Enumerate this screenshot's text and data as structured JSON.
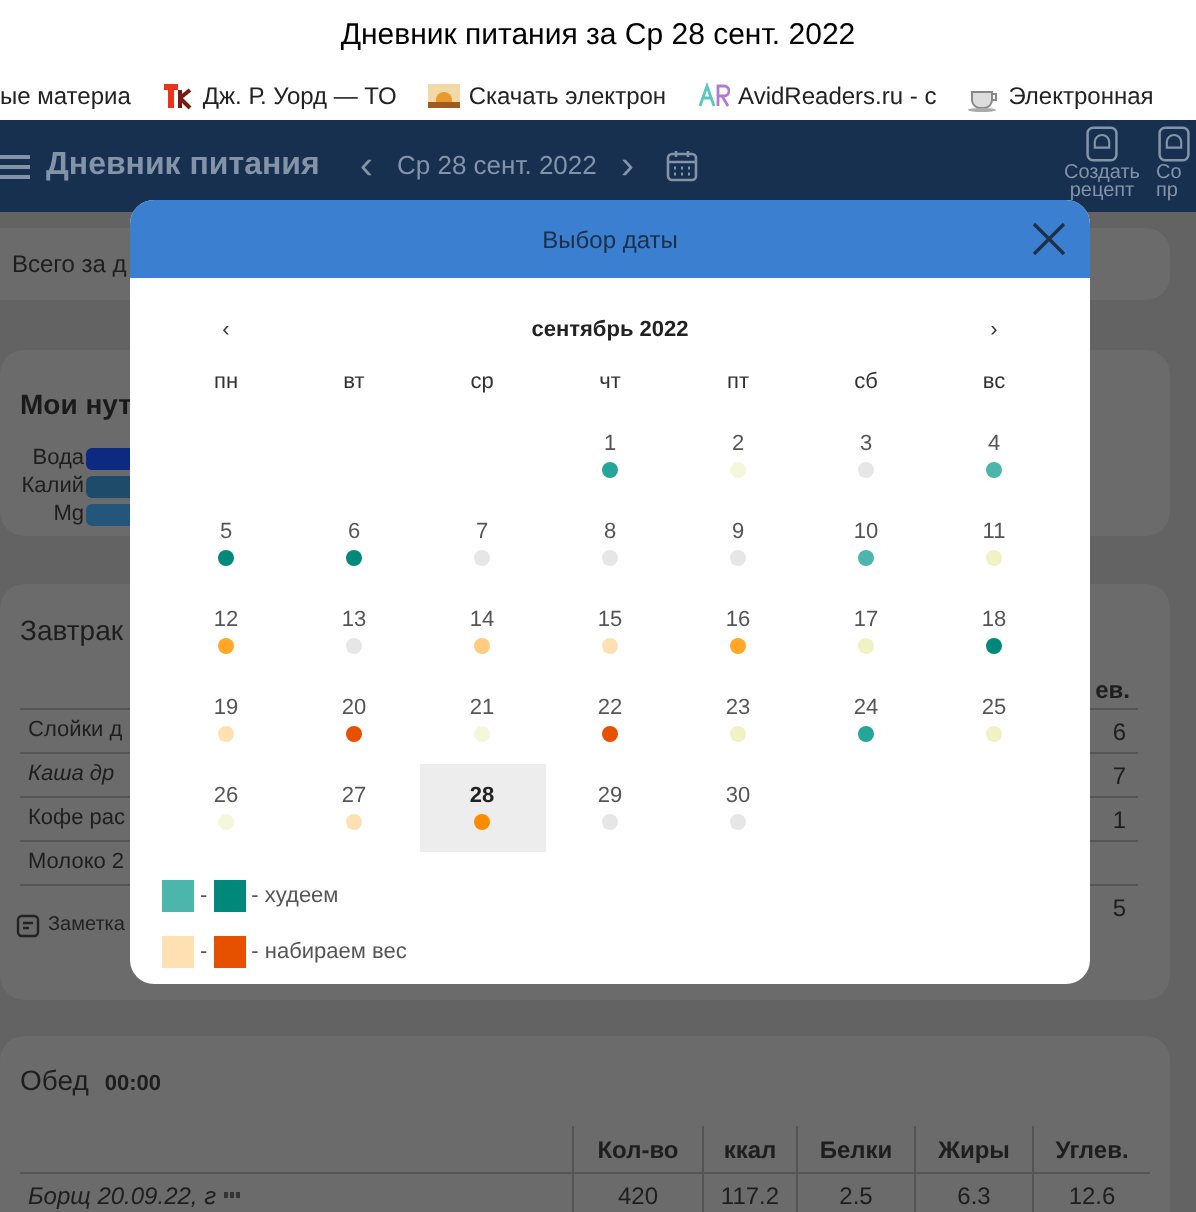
{
  "window": {
    "title": "Дневник питания за Ср 28 сент. 2022"
  },
  "bookmarks": [
    {
      "label": "ые материа"
    },
    {
      "label": "Дж. Р. Уорд — ТО"
    },
    {
      "label": "Скачать электрон"
    },
    {
      "label": "AvidReaders.ru - с"
    },
    {
      "label": "Электронная"
    }
  ],
  "header": {
    "title": "Дневник питания",
    "date": "Ср 28 сент. 2022",
    "prev": "‹",
    "next": "›",
    "actions": [
      [
        "Создать",
        "рецепт"
      ],
      [
        "Со",
        "пр"
      ]
    ]
  },
  "summary": {
    "label": "Всего за д"
  },
  "nutrients": {
    "title": "Мои нут",
    "items": [
      {
        "label": "Вода",
        "color": "#0c2a80"
      },
      {
        "label": "Калий",
        "color": "#1f4b6b"
      },
      {
        "label": "Mg",
        "color": "#24557a"
      }
    ]
  },
  "breakfast": {
    "title": "Завтрак",
    "column_right": "ев.",
    "rows": [
      {
        "name": "Слойки д",
        "italic": false,
        "value": "6"
      },
      {
        "name": "Каша др",
        "italic": true,
        "value": "7"
      },
      {
        "name": "Кофе рас",
        "italic": false,
        "value": "1"
      },
      {
        "name": "Молоко 2",
        "italic": false
      }
    ],
    "total": "5",
    "note": "Заметка"
  },
  "lunch": {
    "title": "Обед",
    "time": "00:00",
    "columns": [
      "Кол-во",
      "ккал",
      "Белки",
      "Жиры",
      "Углев."
    ],
    "rows": [
      {
        "name": "Борщ 20.09.22, г",
        "italic": true,
        "cells": [
          "420",
          "117.2",
          "2.5",
          "6.3",
          "12.6"
        ]
      }
    ]
  },
  "dialog": {
    "title": "Выбор даты",
    "prev": "‹",
    "next": "›",
    "month": "сентябрь 2022",
    "weekdays": [
      "пн",
      "вт",
      "ср",
      "чт",
      "пт",
      "сб",
      "вс"
    ],
    "weeks": [
      {
        "kind": "first",
        "days": [
          {
            "day": "1",
            "color": "#26a69a",
            "selected": false
          },
          {
            "day": "2",
            "color": "#f5f7dc",
            "selected": false
          },
          {
            "day": "3",
            "color": "#e6e6e6",
            "selected": false
          },
          {
            "day": "4",
            "color": "#4db6ac",
            "selected": false
          }
        ]
      },
      {
        "kind": "full",
        "days": [
          {
            "day": "5",
            "color": "#00897b",
            "selected": false
          },
          {
            "day": "6",
            "color": "#00897b",
            "selected": false
          },
          {
            "day": "7",
            "color": "#e6e6e6",
            "selected": false
          },
          {
            "day": "8",
            "color": "#e6e6e6",
            "selected": false
          },
          {
            "day": "9",
            "color": "#e6e6e6",
            "selected": false
          },
          {
            "day": "10",
            "color": "#4db6ac",
            "selected": false
          },
          {
            "day": "11",
            "color": "#eef2c4",
            "selected": false
          }
        ]
      },
      {
        "kind": "full",
        "days": [
          {
            "day": "12",
            "color": "#ffa726",
            "selected": false
          },
          {
            "day": "13",
            "color": "#e6e6e6",
            "selected": false
          },
          {
            "day": "14",
            "color": "#ffcc80",
            "selected": false
          },
          {
            "day": "15",
            "color": "#ffe0b2",
            "selected": false
          },
          {
            "day": "16",
            "color": "#ffa726",
            "selected": false
          },
          {
            "day": "17",
            "color": "#eef2c4",
            "selected": false
          },
          {
            "day": "18",
            "color": "#00897b",
            "selected": false
          }
        ]
      },
      {
        "kind": "full",
        "days": [
          {
            "day": "19",
            "color": "#ffe0b2",
            "selected": false
          },
          {
            "day": "20",
            "color": "#e65100",
            "selected": false
          },
          {
            "day": "21",
            "color": "#f5f7dc",
            "selected": false
          },
          {
            "day": "22",
            "color": "#e65100",
            "selected": false
          },
          {
            "day": "23",
            "color": "#eef2c4",
            "selected": false
          },
          {
            "day": "24",
            "color": "#26a69a",
            "selected": false
          },
          {
            "day": "25",
            "color": "#eef2c4",
            "selected": false
          }
        ]
      },
      {
        "kind": "last",
        "days": [
          {
            "day": "26",
            "color": "#f5f7dc",
            "selected": false
          },
          {
            "day": "27",
            "color": "#ffe0b2",
            "selected": false
          },
          {
            "day": "28",
            "color": "#fb8c00",
            "selected": true
          },
          {
            "day": "29",
            "color": "#e6e6e6",
            "selected": false
          },
          {
            "day": "30",
            "color": "#e6e6e6",
            "selected": false
          }
        ]
      }
    ],
    "legend": [
      {
        "swatches": [
          {
            "color": "#4db6ac"
          },
          {
            "color": "#00897b"
          }
        ],
        "dash": "-",
        "label": "- худеем"
      },
      {
        "swatches": [
          {
            "color": "#ffe0b2"
          },
          {
            "color": "#e65100"
          }
        ],
        "dash": "-",
        "label": "- набираем вес"
      }
    ]
  }
}
